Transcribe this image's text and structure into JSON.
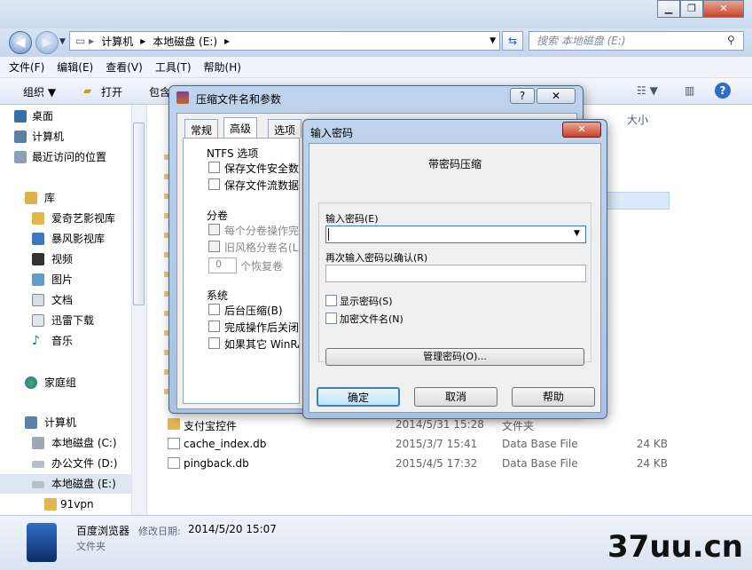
{
  "explorer": {
    "address_segments": [
      "计算机",
      "本地磁盘 (E:)"
    ],
    "search_placeholder": "搜索 本地磁盘 (E:)",
    "menu": [
      "文件(F)",
      "编辑(E)",
      "查看(V)",
      "工具(T)",
      "帮助(H)"
    ],
    "toolbar": {
      "organize": "组织 ▼",
      "open": "打开",
      "include": "包含"
    },
    "column_size": "大小",
    "nav_items": [
      {
        "label": "桌面",
        "level": 1,
        "icon": "desktop-icon"
      },
      {
        "label": "计算机",
        "level": 1,
        "icon": "computer-icon"
      },
      {
        "label": "最近访问的位置",
        "level": 1,
        "icon": "recent-places-icon"
      },
      {
        "label": "库",
        "level": 0,
        "icon": "library-icon"
      },
      {
        "label": "爱奇艺影视库",
        "level": 1,
        "icon": "folder-icon"
      },
      {
        "label": "暴风影视库",
        "level": 1,
        "icon": "video-library-icon"
      },
      {
        "label": "视频",
        "level": 1,
        "icon": "video-icon"
      },
      {
        "label": "图片",
        "level": 1,
        "icon": "pictures-icon"
      },
      {
        "label": "文档",
        "level": 1,
        "icon": "documents-icon"
      },
      {
        "label": "迅雷下载",
        "level": 1,
        "icon": "download-icon"
      },
      {
        "label": "音乐",
        "level": 1,
        "icon": "music-icon"
      },
      {
        "label": "家庭组",
        "level": 0,
        "icon": "homegroup-icon"
      },
      {
        "label": "计算机",
        "level": 0,
        "icon": "computer-icon"
      },
      {
        "label": "本地磁盘 (C:)",
        "level": 1,
        "icon": "drive-c-icon"
      },
      {
        "label": "办公文件 (D:)",
        "level": 1,
        "icon": "drive-icon"
      },
      {
        "label": "本地磁盘 (E:)",
        "level": 1,
        "icon": "drive-icon",
        "selected": true
      },
      {
        "label": "91vpn",
        "level": 2,
        "icon": "folder-icon"
      }
    ],
    "files": [
      {
        "name": "支付宝控件",
        "date": "2014/5/31 15:28",
        "type": "文件夹",
        "size": "",
        "icon": "folder-icon"
      },
      {
        "name": "cache_index.db",
        "date": "2015/3/7 15:41",
        "type": "Data Base File",
        "size": "24 KB",
        "icon": "db-file-icon"
      },
      {
        "name": "pingback.db",
        "date": "2015/4/5 17:32",
        "type": "Data Base File",
        "size": "24 KB",
        "icon": "db-file-icon"
      }
    ],
    "status": {
      "name": "百度浏览器",
      "modified_label": "修改日期:",
      "modified": "2014/5/20 15:07",
      "type": "文件夹"
    }
  },
  "archive_dialog": {
    "title": "压缩文件名和参数",
    "help_btn": "?",
    "close_btn": "✕",
    "tabs": [
      "常规",
      "高级",
      "选项"
    ],
    "ntfs_group": "NTFS 选项",
    "ntfs_options": [
      "保存文件安全数据",
      "保存文件流数据"
    ],
    "split_group": "分卷",
    "split_options": [
      "每个分卷操作完",
      "旧风格分卷名(L)"
    ],
    "recovery_value": "0",
    "recovery_label": "个恢复卷",
    "system_group": "系统",
    "system_options": [
      "后台压缩(B)",
      "完成操作后关闭",
      "如果其它 WinRAR"
    ]
  },
  "password_dialog": {
    "title": "输入密码",
    "close_btn": "✕",
    "heading": "带密码压缩",
    "password_label": "输入密码(E)",
    "password_value": "",
    "confirm_label": "再次输入密码以确认(R)",
    "confirm_value": "",
    "show_password": "显示密码(S)",
    "encrypt_names": "加密文件名(N)",
    "manage_btn": "管理密码(O)...",
    "ok_btn": "确定",
    "cancel_btn": "取消",
    "help_btn": "帮助"
  },
  "watermark": "37uu.cn",
  "colors": {
    "accent": "#3c7fb1",
    "selection": "#cce8ff",
    "title_gradient_top": "#dfe9f5"
  }
}
